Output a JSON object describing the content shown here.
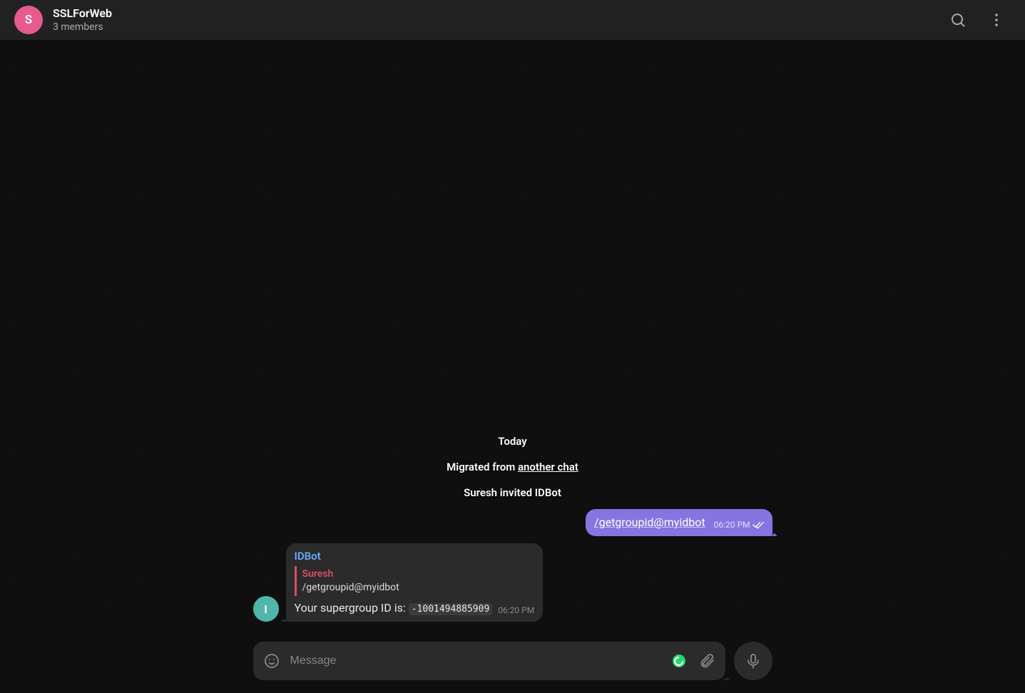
{
  "header": {
    "avatar_letter": "S",
    "title": "SSLForWeb",
    "subtitle": "3 members"
  },
  "service": {
    "date": "Today",
    "migrated_prefix": "Migrated from ",
    "migrated_link": "another chat",
    "invite": "Suresh invited IDBot"
  },
  "messages": {
    "out1": {
      "text": "/getgroupid@myidbot",
      "time": "06:20 PM"
    },
    "in1": {
      "avatar_letter": "I",
      "sender": "IDBot",
      "reply_name": "Suresh",
      "reply_text": "/getgroupid@myidbot",
      "body_prefix": "Your supergroup ID is: ",
      "body_code": "-1001494885909",
      "time": "06:20 PM"
    }
  },
  "composer": {
    "placeholder": "Message"
  }
}
